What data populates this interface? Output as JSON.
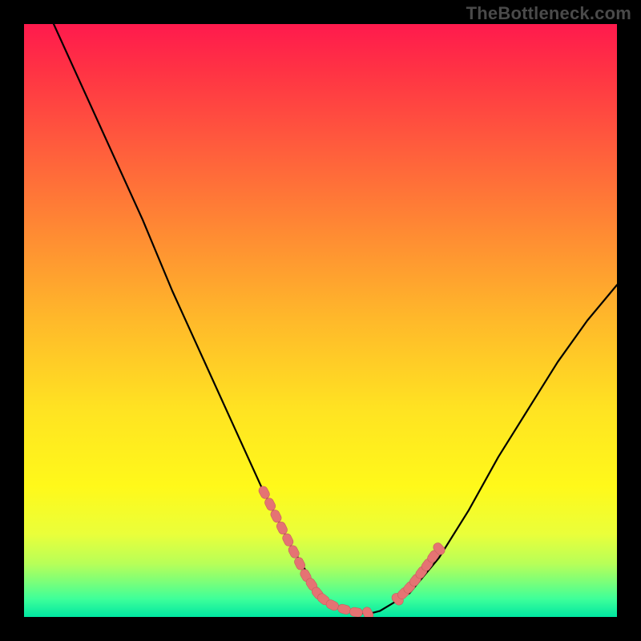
{
  "attribution": "TheBottleneck.com",
  "colors": {
    "page_bg": "#000000",
    "gradient_top": "#ff1a4d",
    "gradient_bottom": "#00e6a1",
    "curve": "#000000",
    "marker_fill": "#e57373",
    "marker_stroke": "#c95f5f"
  },
  "chart_data": {
    "type": "line",
    "title": "",
    "xlabel": "",
    "ylabel": "",
    "xlim": [
      0,
      100
    ],
    "ylim": [
      0,
      100
    ],
    "series": [
      {
        "name": "curve",
        "x": [
          5,
          10,
          15,
          20,
          25,
          30,
          35,
          40,
          45,
          48,
          50,
          52,
          55,
          58,
          60,
          65,
          70,
          75,
          80,
          85,
          90,
          95,
          100
        ],
        "y": [
          100,
          89,
          78,
          67,
          55,
          44,
          33,
          22,
          12,
          7,
          4,
          2,
          1,
          0.5,
          1,
          4,
          10,
          18,
          27,
          35,
          43,
          50,
          56
        ]
      }
    ],
    "markers_left": {
      "name": "left-cluster",
      "x": [
        40.5,
        41.5,
        42.5,
        43.5,
        44.5,
        45.5,
        46.5,
        47.5,
        48.5,
        49.5,
        50.5,
        52.0,
        54.0,
        56.0,
        58.0
      ],
      "y": [
        21,
        19,
        17,
        15,
        13,
        11,
        9,
        7,
        5.5,
        4,
        3,
        2,
        1.3,
        0.8,
        0.6
      ]
    },
    "markers_right": {
      "name": "right-cluster",
      "x": [
        63.0,
        64.0,
        65.0,
        66.0,
        67.0,
        68.0,
        69.0,
        70.0
      ],
      "y": [
        3.0,
        4.0,
        5.0,
        6.2,
        7.5,
        8.8,
        10.2,
        11.5
      ]
    }
  }
}
